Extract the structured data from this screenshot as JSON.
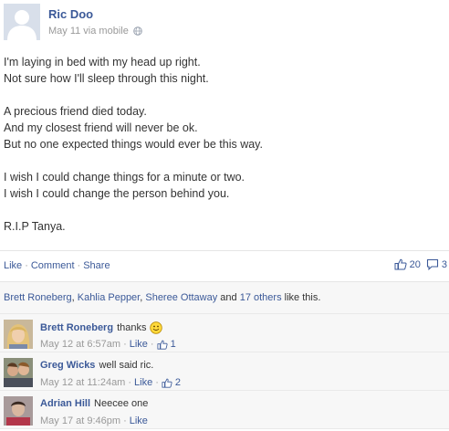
{
  "post": {
    "author": "Ric Doo",
    "meta": "May 11 via mobile",
    "privacy_icon": "globe-icon",
    "lines": [
      "I'm laying in bed with my head up right.",
      "Not sure how I'll sleep through this night.",
      "",
      "A precious friend died today.",
      "And my closest friend will never be ok.",
      "But no one expected things would ever be this way.",
      "",
      "I wish I could change things for a minute or two.",
      "I wish I could change the person behind you.",
      "",
      "R.I.P Tanya."
    ]
  },
  "actions": {
    "like": "Like",
    "comment": "Comment",
    "share": "Share",
    "sep": "·",
    "like_count": "20",
    "comment_count": "3"
  },
  "likes": {
    "names": [
      "Brett Roneberg",
      "Kahlia Pepper",
      "Sheree Ottaway"
    ],
    "comma": ",",
    "and": "and",
    "others": "17 others",
    "suffix": "like this."
  },
  "comments": [
    {
      "author": "Brett Roneberg",
      "text": "thanks",
      "time": "May 12 at 6:57am",
      "like": "Like",
      "likes": "1",
      "has_smiley": true
    },
    {
      "author": "Greg Wicks",
      "text": "well said ric.",
      "time": "May 12 at 11:24am",
      "like": "Like",
      "likes": "2",
      "has_smiley": false
    },
    {
      "author": "Adrian Hill",
      "text": "Neecee one",
      "time": "May 17 at 9:46pm",
      "like": "Like",
      "likes": "",
      "has_smiley": false
    }
  ],
  "colors": {
    "link": "#3b5998",
    "muted": "#999999",
    "panel": "#f7f7f7"
  }
}
